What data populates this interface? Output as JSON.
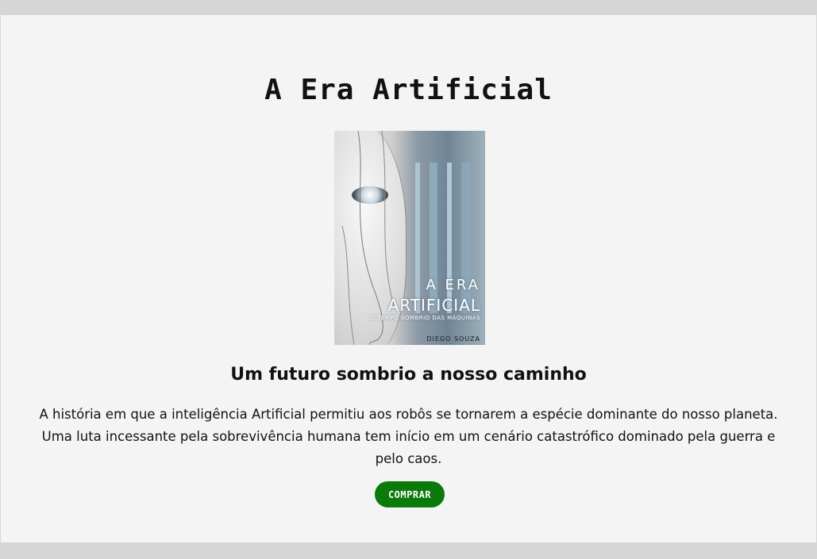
{
  "page": {
    "title": "A Era Artificial",
    "subtitle": "Um futuro sombrio a nosso caminho",
    "description": "A história em que a inteligência Artificial permitiu aos robôs se tornarem a espécie dominante do nosso planeta. Uma luta incessante pela sobrevivência humana tem início em um cenário catastrófico dominado pela guerra e pelo caos.",
    "buy_label": "COMPRAR"
  },
  "book_cover": {
    "line1": "A ERA",
    "line2": "ARTIFICIAL",
    "tagline": "O TEMPO SOMBRIO DAS MÁQUINAS",
    "author": "DIEGO SOUZA"
  },
  "colors": {
    "background": "#d6d6d6",
    "panel": "#f4f4f4",
    "button": "#0a7a0a",
    "button_text": "#ffffff"
  }
}
